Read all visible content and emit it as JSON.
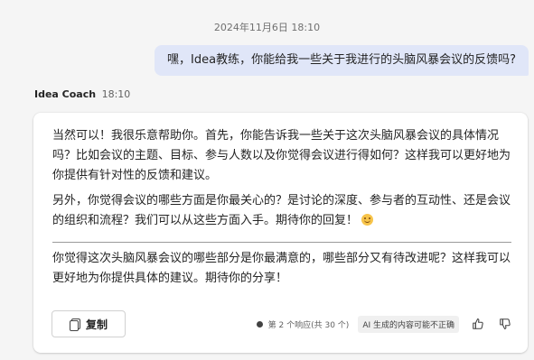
{
  "conversation": {
    "timestamp": "2024年11月6日 18:10",
    "user_message": "嘿，Idea教练，你能给我一些关于我进行的头脑风暴会议的反馈吗?",
    "bot": {
      "name": "Idea Coach",
      "time": "18:10",
      "paragraph_1": "当然可以！我很乐意帮助你。首先，你能告诉我一些关于这次头脑风暴会议的具体情况吗？比如会议的主题、目标、参与人数以及你觉得会议进行得如何？这样我可以更好地为你提供有针对性的反馈和建议。",
      "paragraph_2": "另外，你觉得会议的哪些方面是你最关心的？是讨论的深度、参与者的互动性、还是会议的组织和流程？我们可以从这些方面入手。期待你的回复！",
      "paragraph_3": "你觉得这次头脑风暴会议的哪些部分是你最满意的，哪些部分又有待改进呢？这样我可以更好地为你提供具体的建议。期待你的分享！"
    }
  },
  "footer": {
    "copy_label": "复制",
    "response_count": "第 2 个响应(共 30 个)",
    "ai_disclaimer": "AI 生成的内容可能不正确"
  },
  "icons": {
    "copy": "copy-icon",
    "like": "thumbs-up-icon",
    "dislike": "thumbs-down-icon",
    "emoji": "smiling-face-icon"
  }
}
